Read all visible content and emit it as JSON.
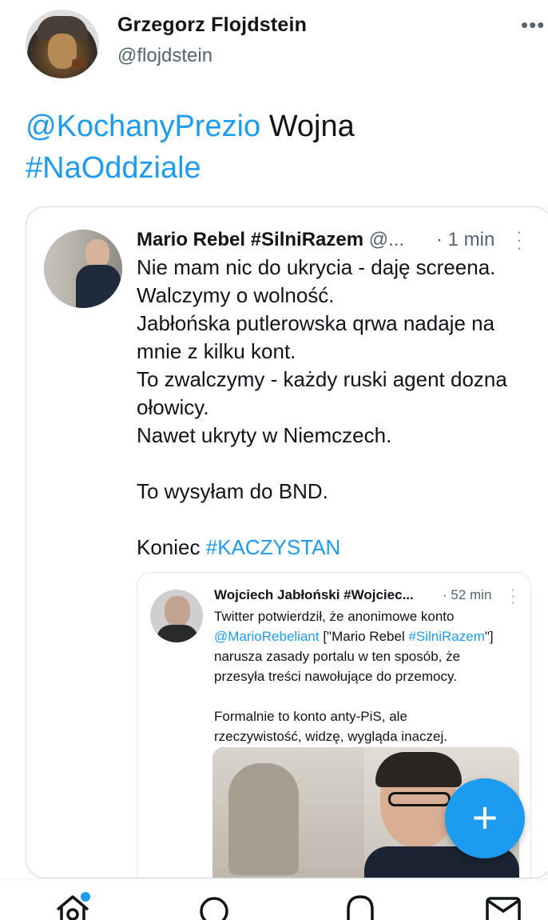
{
  "tweet": {
    "author_name": "Grzegorz Flojdstein",
    "author_handle": "@flojdstein",
    "more_icon": "more-horizontal-icon",
    "text_mention": "@KochanyPrezio",
    "text_body": " Wojna",
    "text_hashtag": "#NaOddziale"
  },
  "quoted": {
    "author_name": "Mario Rebel #SilniRazem",
    "author_handle": " @...",
    "time": "· 1 min",
    "lines": [
      "Nie mam nic do ukrycia - daję screena.",
      "Walczymy o wolność.",
      "Jabłońska putlerowska qrwa nadaje na",
      "mnie z kilku kont.",
      "To zwalczymy - każdy ruski agent dozna",
      "ołowicy.",
      "Nawet ukryty w Niemczech."
    ],
    "line_bnd": "To wysyłam do BND.",
    "line_end_prefix": "Koniec ",
    "line_end_hashtag": "#KACZYSTAN"
  },
  "inner": {
    "author_name": "Wojciech Jabłoński #Wojciec...",
    "time": "· 52 min",
    "line1": "Twitter potwierdził, że anonimowe konto",
    "line2_mention": "@MarioRebeliant",
    "line2_mid": " [\"Mario Rebel ",
    "line2_hashtag": "#SilniRazem",
    "line2_end": "\"]",
    "line3": "narusza zasady portalu w ten sposób, że",
    "line4": "przesyła treści nawołujące do przemocy.",
    "line5": "Formalnie to konto anty-PiS, ale",
    "line6": "rzeczywistość, widzę, wygląda inaczej."
  },
  "fab": {
    "label": "+",
    "icon": "compose-plus-icon"
  },
  "nav": {
    "items": [
      "home-icon",
      "search-icon",
      "notifications-icon",
      "messages-icon"
    ],
    "home_has_notification": true
  },
  "colors": {
    "link": "#1d9bf0",
    "text": "#0f1419",
    "muted": "#536471",
    "border": "#cfd9de"
  }
}
